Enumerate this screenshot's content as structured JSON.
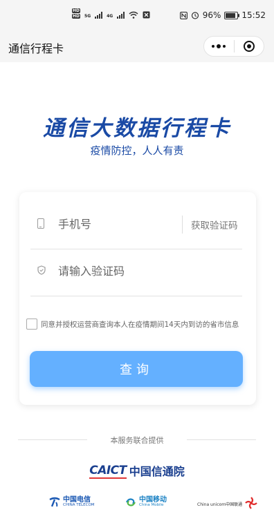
{
  "status_bar": {
    "network_a": "5G",
    "network_b": "4G",
    "battery": "96%",
    "time": "15:52"
  },
  "nav": {
    "title": "通信行程卡"
  },
  "hero": {
    "title": "通信大数据行程卡",
    "subtitle": "疫情防控，人人有责"
  },
  "form": {
    "phone_placeholder": "手机号",
    "get_code_label": "获取验证码",
    "code_placeholder": "请输入验证码",
    "agreement_text": "同意并授权运营商查询本人在疫情期间14天内到访的省市信息",
    "submit_label": "查询"
  },
  "footer": {
    "provided_by": "本服务联合提供",
    "caict_en": "CAICT",
    "caict_cn": "中国信通院",
    "telecom_cn": "中国电信",
    "telecom_en": "CHINA TELECOM",
    "mobile_cn": "中国移动",
    "mobile_en": "China Mobile",
    "unicom_cn": "China unicom中国联通"
  },
  "colors": {
    "brand_blue": "#1a4aa5",
    "button_blue": "#64b0ff"
  },
  "icons": [
    "hd-icon",
    "signal-icon",
    "wifi-icon",
    "nfc-icon",
    "alarm-icon",
    "battery-icon",
    "more-icon",
    "close-target-icon",
    "phone-icon",
    "shield-icon"
  ]
}
